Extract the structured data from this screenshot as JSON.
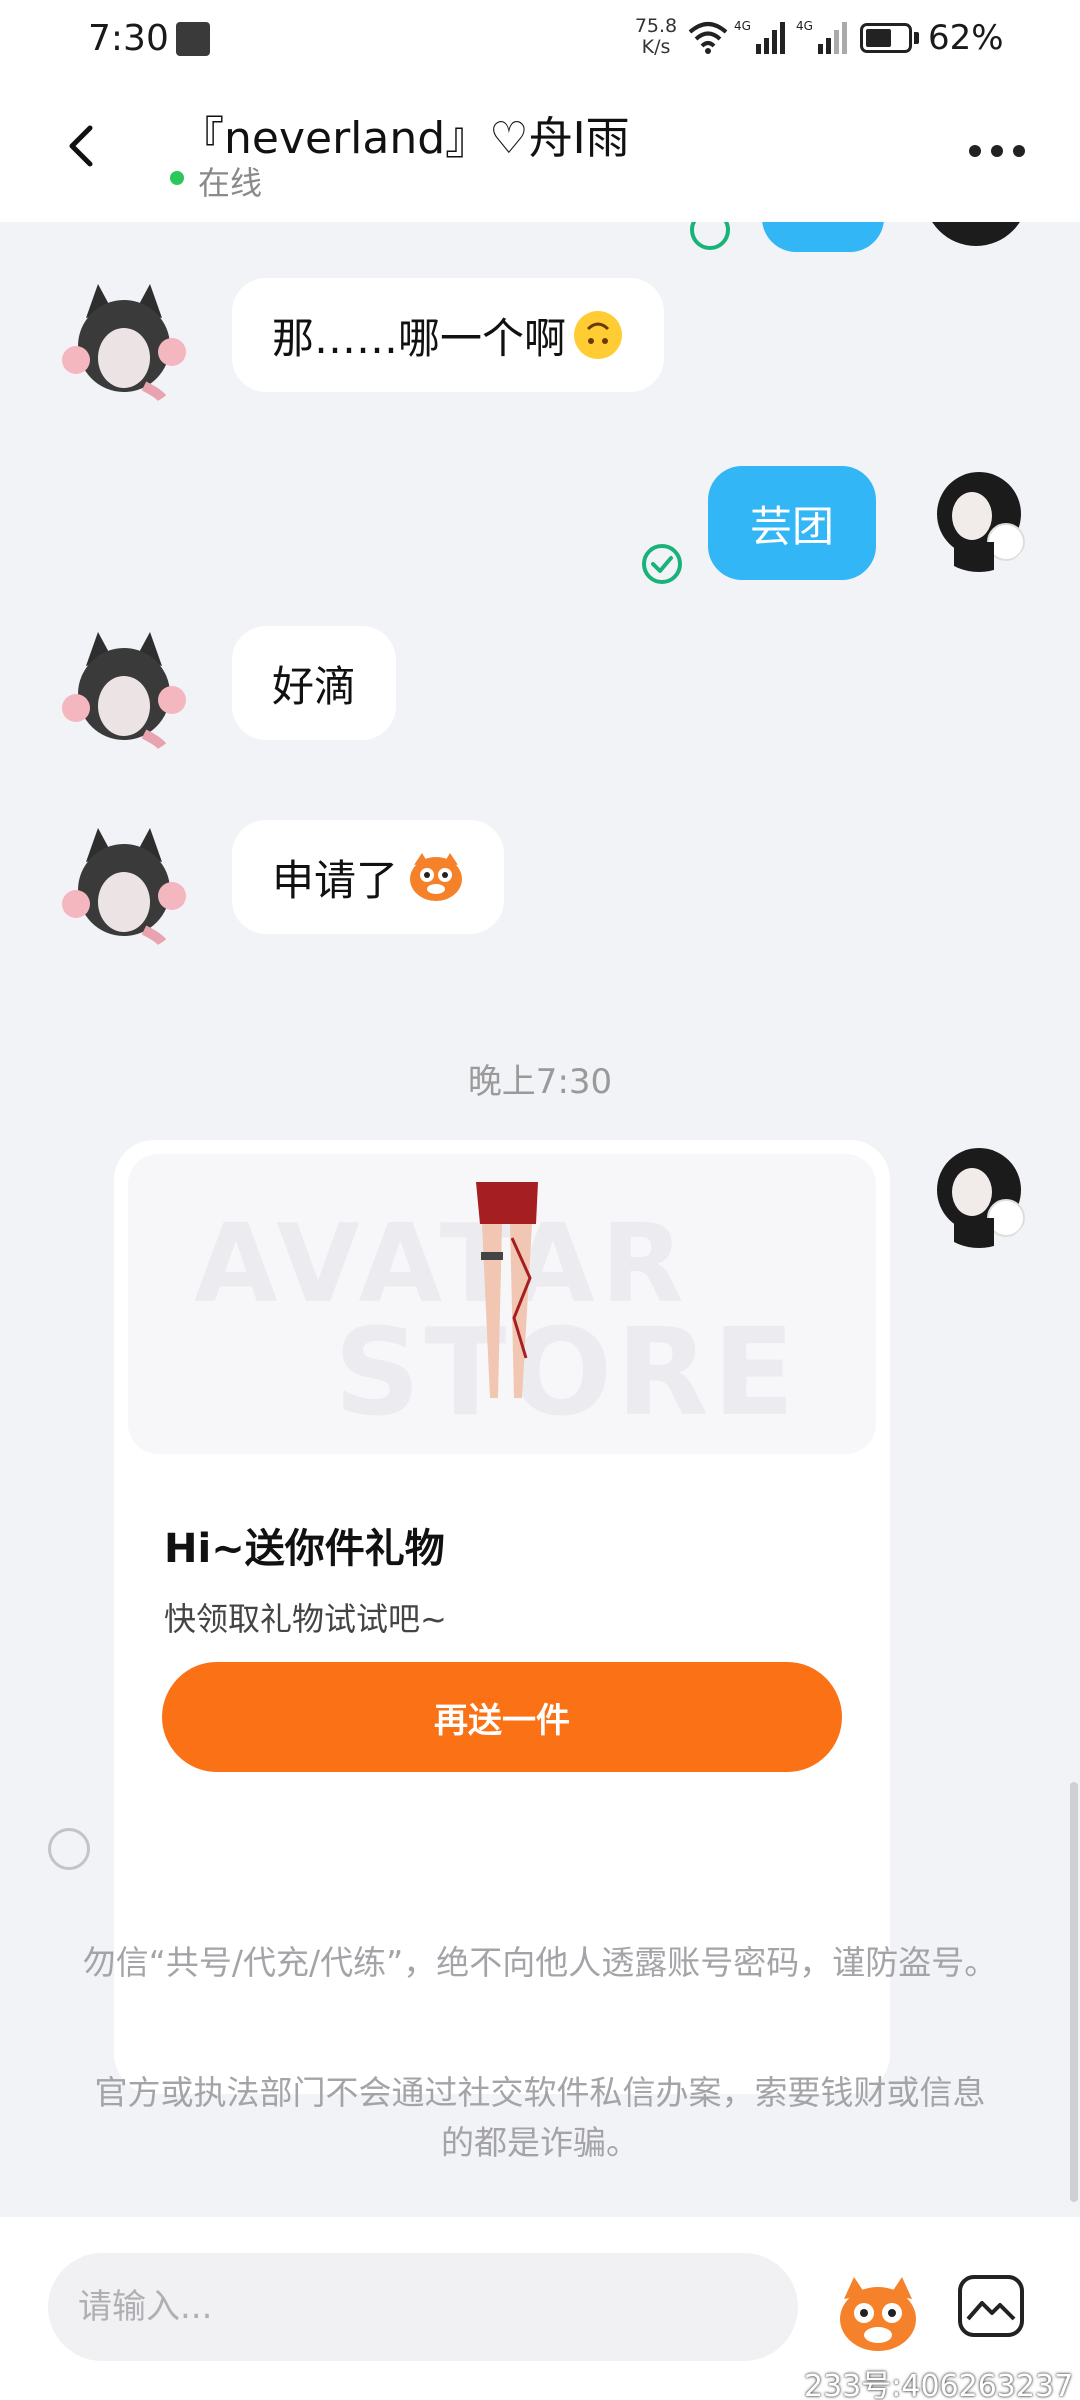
{
  "status_bar": {
    "time": "7:30",
    "net_speed_value": "75.8",
    "net_speed_unit": "K/s",
    "battery_percent_text": "62%",
    "battery_level": 0.62,
    "icons": [
      "app-notification-icon",
      "wifi-icon",
      "signal-4g-icon",
      "signal-4g-icon",
      "battery-icon"
    ]
  },
  "header": {
    "title": "『neverland』♡舟I雨",
    "status": "在线",
    "status_color": "#2bc75a"
  },
  "messages": [
    {
      "side": "left",
      "text": "那……哪一个啊",
      "emoji": "upside-down-face-emoji"
    },
    {
      "side": "right",
      "text": "芸团",
      "read": true
    },
    {
      "side": "left",
      "text": "好滴"
    },
    {
      "side": "left",
      "text": "申请了",
      "emoji": "mascot-emoji"
    }
  ],
  "timestamp": "晚上7:30",
  "gift_card": {
    "watermark": [
      "AVATAR",
      "STORE"
    ],
    "title": "Hi~送你件礼物",
    "description": "快领取礼物试试吧~",
    "button_label": "再送一件"
  },
  "notices": [
    "勿信“共号/代充/代练”，绝不向他人透露账号密码，谨防盗号。",
    "官方或执法部门不会通过社交软件私信办案，索要钱财或信息的都是诈骗。"
  ],
  "input": {
    "placeholder": "请输入..."
  },
  "footer_id": "233号:406263237",
  "colors": {
    "outgoing_bubble": "#33b6f5",
    "accent_button": "#fb7216",
    "read_check": "#19b37a",
    "background": "#f2f3f7"
  }
}
